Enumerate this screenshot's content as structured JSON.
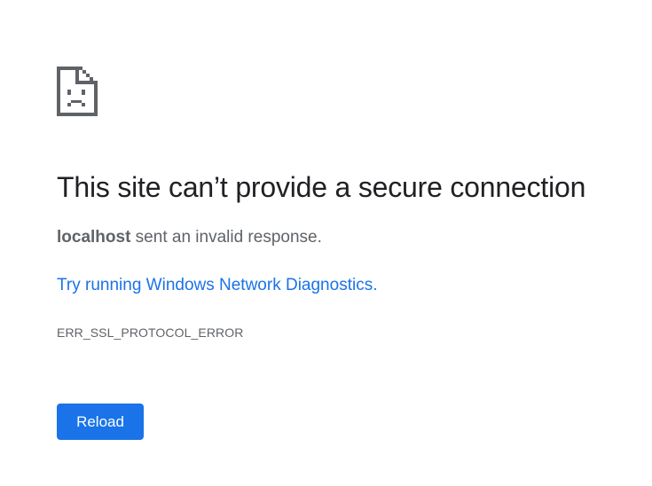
{
  "error_page": {
    "icon": "sad-page-icon",
    "title": "This site can’t provide a secure connection",
    "host": "localhost",
    "summary_rest": " sent an invalid response.",
    "diagnose_link": "Try running Windows Network Diagnostics",
    "diagnose_suffix": ".",
    "error_code": "ERR_SSL_PROTOCOL_ERROR",
    "reload_label": "Reload"
  },
  "colors": {
    "accent": "#1a73e8",
    "title_text": "#202124",
    "secondary_text": "#5f6368",
    "icon": "#5f6368"
  }
}
